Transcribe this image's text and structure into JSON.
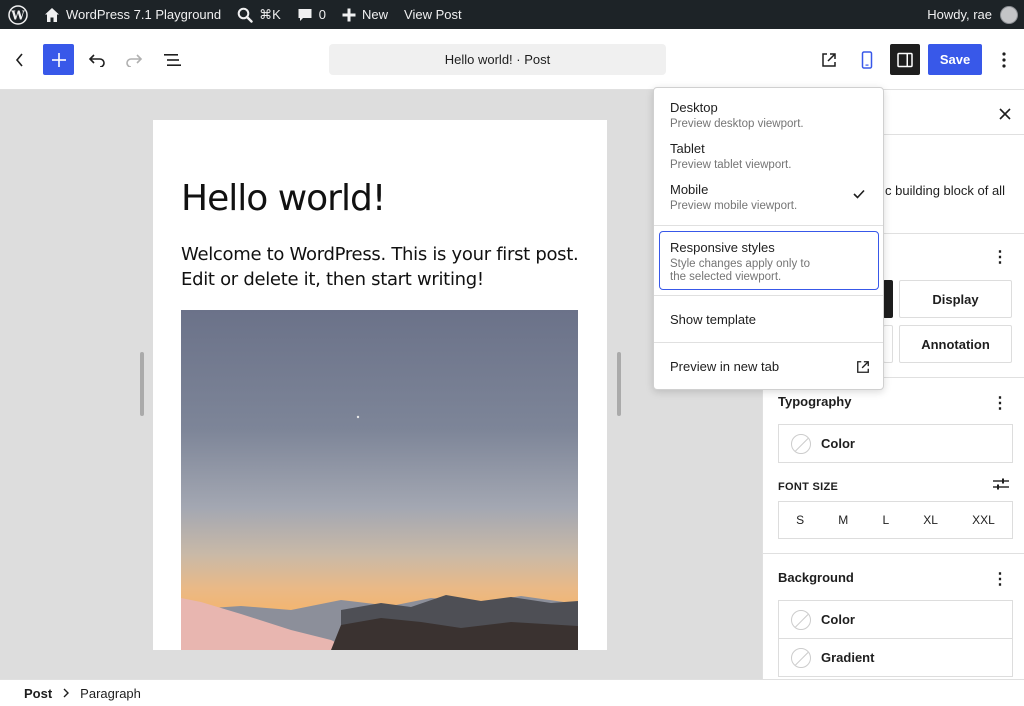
{
  "adminbar": {
    "wp_logo_icon": "wordpress-logo-icon",
    "site_icon": "home-icon",
    "site_name": "WordPress 7.1 Playground",
    "search_icon": "search-icon",
    "command_shortcut": "⌘K",
    "comments_icon": "comment-icon",
    "comments_count": "0",
    "new_icon": "plus-icon",
    "new_label": "New",
    "view_post": "View Post",
    "greeting": "Howdy, rae"
  },
  "header": {
    "document_title": "Hello world! · Post",
    "save_label": "Save"
  },
  "post": {
    "title": "Hello world!",
    "paragraph": "Welcome to WordPress. This is your first post. Edit or delete it, then start writing!"
  },
  "sidebar": {
    "block_description_fragment": "c building block of all",
    "style_buttons": [
      "Display",
      "Annotation"
    ],
    "typography": {
      "heading": "Typography",
      "color_label": "Color",
      "font_size_label": "FONT SIZE",
      "sizes": [
        "S",
        "M",
        "L",
        "XL",
        "XXL"
      ]
    },
    "background": {
      "heading": "Background",
      "color_label": "Color",
      "gradient_label": "Gradient"
    }
  },
  "preview_menu": {
    "items": [
      {
        "label": "Desktop",
        "description": "Preview desktop viewport."
      },
      {
        "label": "Tablet",
        "description": "Preview tablet viewport."
      },
      {
        "label": "Mobile",
        "description": "Preview mobile viewport.",
        "selected": true
      }
    ],
    "responsive": {
      "label": "Responsive styles",
      "description_line1": "Style changes apply only to",
      "description_line2": "the selected viewport."
    },
    "show_template": "Show template",
    "preview_new_tab": "Preview in new tab"
  },
  "footer": {
    "breadcrumb": [
      "Post",
      "Paragraph"
    ]
  },
  "colors": {
    "accent": "#3858e9",
    "adminbar_bg": "#1d2327",
    "canvas_bg": "#dddddd"
  }
}
